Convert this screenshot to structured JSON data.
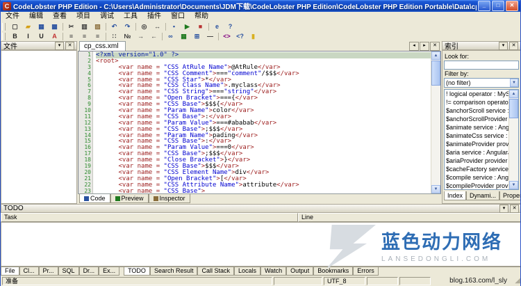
{
  "window": {
    "title": "CodeLobster PHP Edition - C:\\Users\\Administrator\\Documents\\JDM下载\\CodeLobster PHP Edition\\CodeLobster PHP Edition Portable\\Data\\cp_css.xml"
  },
  "icons": {
    "app": "C",
    "minimize": "_",
    "maximize": "□",
    "close": "✕",
    "panel_menu": "▾",
    "panel_close": "✕",
    "tab_scroll_left": "◂",
    "tab_scroll_right": "▸",
    "tab_close": "✕",
    "dropdown": "▼",
    "scroll_up": "▲",
    "scroll_down": "▼",
    "resize_grip": "◢"
  },
  "menu": {
    "items": [
      "文件",
      "编辑",
      "查看",
      "项目",
      "调试",
      "工具",
      "插件",
      "窗口",
      "帮助"
    ]
  },
  "toolbar_main": {
    "icons": [
      {
        "name": "new-file",
        "glyph": "▢",
        "color": "#3b3b3b"
      },
      {
        "name": "open-file",
        "glyph": "▰",
        "color": "#d4a017"
      },
      {
        "name": "save-file",
        "glyph": "▦",
        "color": "#2a52a0"
      },
      {
        "name": "save-all",
        "glyph": "▩",
        "color": "#2a52a0"
      },
      {
        "sep": true
      },
      {
        "name": "cut",
        "glyph": "✂",
        "color": "#3b3b3b"
      },
      {
        "name": "copy",
        "glyph": "▥",
        "color": "#3b3b3b"
      },
      {
        "name": "paste",
        "glyph": "▨",
        "color": "#8a6d3b"
      },
      {
        "sep": true
      },
      {
        "name": "undo",
        "glyph": "↶",
        "color": "#2a52a0"
      },
      {
        "name": "redo",
        "glyph": "↷",
        "color": "#2a52a0"
      },
      {
        "sep": true
      },
      {
        "name": "find",
        "glyph": "◎",
        "color": "#3b3b3b"
      },
      {
        "name": "replace",
        "glyph": "↔",
        "color": "#3b3b3b"
      },
      {
        "sep": true
      },
      {
        "name": "bookmark",
        "glyph": "▪",
        "color": "#2a52a0"
      },
      {
        "name": "run",
        "glyph": "▶",
        "color": "#1f7a1f"
      },
      {
        "name": "stop",
        "glyph": "■",
        "color": "#b83232"
      },
      {
        "sep": true
      },
      {
        "name": "preview-browser",
        "glyph": "e",
        "color": "#2a52a0"
      },
      {
        "name": "help",
        "glyph": "?",
        "color": "#2a52a0"
      }
    ]
  },
  "toolbar_format": {
    "icons": [
      {
        "name": "bold",
        "glyph": "B",
        "color": "#222222"
      },
      {
        "name": "italic",
        "glyph": "I",
        "color": "#222222"
      },
      {
        "name": "underline",
        "glyph": "U",
        "color": "#222222"
      },
      {
        "name": "font-color",
        "glyph": "A",
        "color": "#c03030"
      },
      {
        "sep": true
      },
      {
        "name": "align-left",
        "glyph": "≡",
        "color": "#3b3b3b"
      },
      {
        "name": "align-center",
        "glyph": "≡",
        "color": "#3b3b3b"
      },
      {
        "name": "align-right",
        "glyph": "≡",
        "color": "#3b3b3b"
      },
      {
        "sep": true
      },
      {
        "name": "list-bullets",
        "glyph": "∷",
        "color": "#3b3b3b"
      },
      {
        "name": "list-numbered",
        "glyph": "№",
        "color": "#3b3b3b"
      },
      {
        "name": "indent",
        "glyph": "→",
        "color": "#3b3b3b"
      },
      {
        "name": "outdent",
        "glyph": "←",
        "color": "#3b3b3b"
      },
      {
        "sep": true
      },
      {
        "name": "insert-link",
        "glyph": "∞",
        "color": "#2a52a0"
      },
      {
        "name": "insert-image",
        "glyph": "▦",
        "color": "#1f7a1f"
      },
      {
        "name": "insert-table",
        "glyph": "⊞",
        "color": "#2a52a0"
      },
      {
        "name": "insert-hr",
        "glyph": "―",
        "color": "#3b3b3b"
      },
      {
        "sep": true
      },
      {
        "name": "html-tag",
        "glyph": "<>",
        "color": "#800080"
      },
      {
        "name": "php-tag",
        "glyph": "<?",
        "color": "#2a52a0"
      },
      {
        "name": "highlight-color",
        "glyph": "▮",
        "color": "#d8b020"
      }
    ]
  },
  "left_panel": {
    "title": "文件"
  },
  "editor": {
    "tab": "cp_css.xml",
    "current_line": 1,
    "lines": [
      "<?xml version=\"1.0\" ?>",
      "<root>",
      "      <var name = \"CSS AtRule Name\">@AtRule</var>",
      "      <var name = \"CSS Comment\">===\"comment\"/$$$</var>",
      "      <var name = \"CSS Star\">*</var>",
      "      <var name = \"CSS Class Name\">.myclass</var>",
      "      <var name = \"CSS String\">===\"string\"</var>",
      "      <var name = \"Open Bracket\">==={</var>",
      "      <var name = \"CSS Base\">$$${</var>",
      "      <var name = \"Param Name\">color</var>",
      "      <var name = \"CSS Base\">:</var>",
      "      <var name = \"Param Value\">===#ababab</var>",
      "      <var name = \"CSS Base\">;$$$</var>",
      "      <var name = \"Param Name\">pading</var>",
      "      <var name = \"CSS Base\">:</var>",
      "      <var name = \"Param Value\">===0</var>",
      "      <var name = \"CSS Base\">;$$$</var>",
      "      <var name = \"Close Bracket\">}</var>",
      "      <var name = \"CSS Base\">$$$</var>",
      "      <var name = \"CSS Element Name\">div</var>",
      "      <var name = \"Open Bracket\">[</var>",
      "      <var name = \"CSS Attribute Name\">attribute</var>",
      "      <var name = \"CSS Base\">"
    ],
    "bottom_tabs": [
      "Code",
      "Preview",
      "Inspector"
    ],
    "active_bottom_tab": "Code"
  },
  "right_panel": {
    "title": "索引",
    "look_for_label": "Look for:",
    "look_for_value": "",
    "filter_label": "Filter by:",
    "filter_value": "(no filter)",
    "items": [
      "! logical operator : MySQL",
      "!= comparison operator : MySQL",
      "$anchorScroll service : AngularJS",
      "$anchorScrollProvider provider : AngularJS",
      "$animate service : AngularJS",
      "$animateCss service : AngularJS",
      "$animateProvider provider : AngularJS",
      "$aria service : AngularJS",
      "$ariaProvider provider : AngularJS",
      "$cacheFactory service : AngularJS",
      "$compile service : AngularJS",
      "$compileProvider provider : AngularJS"
    ],
    "tabs": [
      "Index",
      "Dynami...",
      "Proper..."
    ],
    "active_tab": "Index"
  },
  "todo_panel": {
    "title": "TODO",
    "columns": [
      "Task",
      "Line"
    ]
  },
  "bottom_tabs": {
    "left": [
      "File",
      "Cl...",
      "Pr...",
      "SQL",
      "Dr...",
      "Ex..."
    ],
    "active_left": "File",
    "panel": [
      "TODO",
      "Search Result",
      "Call Stack",
      "Locals",
      "Watch",
      "Output",
      "Bookmarks",
      "Errors"
    ],
    "active_panel": "TODO"
  },
  "status_bar": {
    "cells": [
      "准备",
      "",
      "UTF_8",
      "",
      ""
    ]
  },
  "watermark": {
    "brand": "蓝色动力网络",
    "domain": "LANSEDONGLI.COM",
    "blog": "blog.163.com/l_sly"
  },
  "colors": {
    "accent": "#2e6db4",
    "selection_line": "#c9d7c2",
    "tag": "#9c1c1c",
    "string": "#0000d0"
  }
}
